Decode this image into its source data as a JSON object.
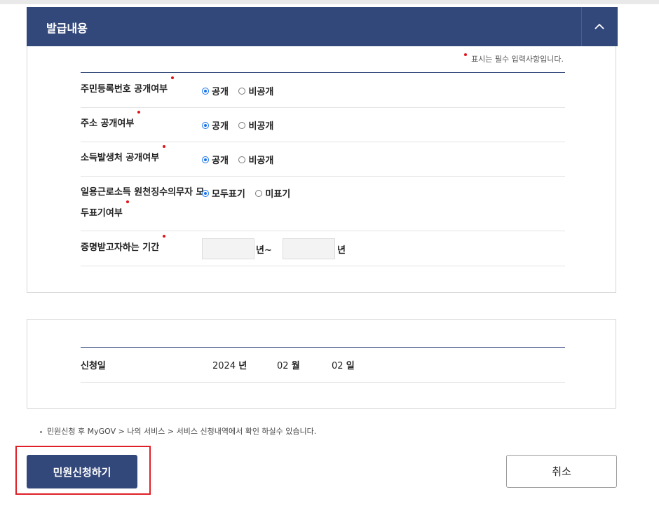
{
  "section_issue": {
    "title": "발급내용",
    "required_note": "표시는 필수 입력사항입니다.",
    "rows": [
      {
        "label": "주민등록번호 공개여부",
        "options": [
          "공개",
          "비공개"
        ],
        "selected": 0
      },
      {
        "label": "주소 공개여부",
        "options": [
          "공개",
          "비공개"
        ],
        "selected": 0
      },
      {
        "label": "소득발생처 공개여부",
        "options": [
          "공개",
          "비공개"
        ],
        "selected": 0
      },
      {
        "label_line1": "일용근로소득 원천징수의무자 모",
        "label_line2": "두표기여부",
        "options": [
          "모두표기",
          "미표기"
        ],
        "selected": 0
      },
      {
        "label": "증명받고자하는 기간",
        "year_from": "",
        "year_to": "",
        "unit_from": "년~",
        "unit_to": "년"
      }
    ]
  },
  "section_date": {
    "label": "신청일",
    "year": "2024",
    "year_unit": "년",
    "month": "02",
    "month_unit": "월",
    "day": "02",
    "day_unit": "일"
  },
  "notice": "민원신청 후 MyGOV > 나의 서비스 > 서비스 신청내역에서 확인 하실수 있습니다.",
  "buttons": {
    "submit": "민원신청하기",
    "cancel": "취소"
  },
  "colors": {
    "primary": "#33487a",
    "required": "#e0161b",
    "highlight": "#e01f26",
    "radio": "#1a73e8"
  }
}
